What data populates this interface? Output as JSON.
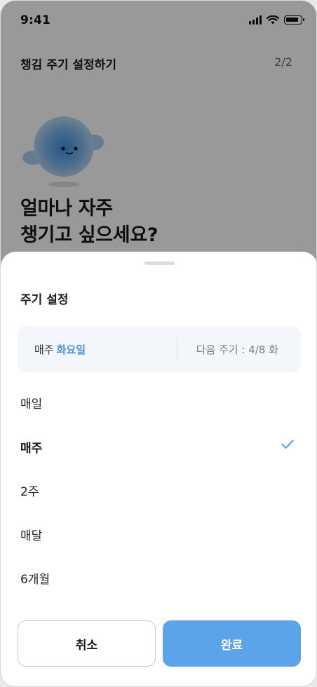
{
  "status_bar": {
    "time": "9:41",
    "icons": [
      "signal-icon",
      "wifi-icon",
      "battery-icon"
    ]
  },
  "header": {
    "title": "챙김 주기 설정하기",
    "step": "2/2"
  },
  "hero": {
    "line1": "얼마나 자주",
    "line2": "챙기고 싶으세요?"
  },
  "sheet": {
    "title": "주기 설정",
    "summary": {
      "freq": "매주",
      "day": "화요일",
      "next": "다음 주기 : 4/8 화"
    },
    "options": [
      {
        "label": "매일",
        "selected": false
      },
      {
        "label": "매주",
        "selected": true
      },
      {
        "label": "2주",
        "selected": false
      },
      {
        "label": "매달",
        "selected": false
      },
      {
        "label": "6개월",
        "selected": false
      }
    ],
    "cancel_label": "취소",
    "done_label": "완료"
  },
  "colors": {
    "accent": "#5ba4ea",
    "accent_text": "#4a90d9",
    "overlay": "rgba(0,0,0,0.40)"
  }
}
